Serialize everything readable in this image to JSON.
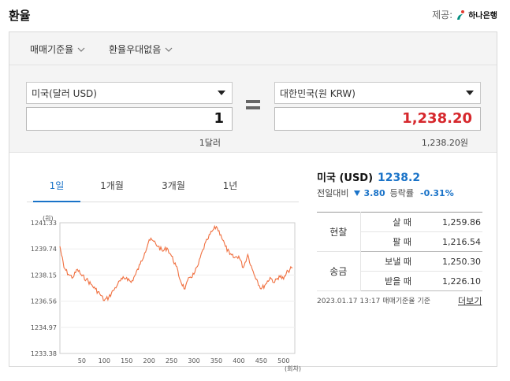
{
  "header": {
    "title": "환율",
    "provider_label": "제공:",
    "provider_name": "하나은행"
  },
  "tabs": [
    {
      "label": "매매기준율"
    },
    {
      "label": "환율우대없음"
    }
  ],
  "converter": {
    "from_currency": "미국(달러 USD)",
    "from_amount": "1",
    "from_sub": "1달러",
    "to_currency": "대한민국(원 KRW)",
    "to_amount": "1,238.20",
    "to_sub": "1,238.20원"
  },
  "periods": [
    {
      "label": "1일",
      "active": true
    },
    {
      "label": "1개월",
      "active": false
    },
    {
      "label": "3개월",
      "active": false
    },
    {
      "label": "1년",
      "active": false
    }
  ],
  "summary": {
    "country": "미국 (USD)",
    "rate": "1238.2",
    "compare_label": "전일대비",
    "change": "3.80",
    "ratio_label": "등락률",
    "ratio": "-0.31%"
  },
  "rates": {
    "cash_label": "현찰",
    "remit_label": "송금",
    "rows": [
      {
        "kind": "살 때",
        "value": "1,259.86"
      },
      {
        "kind": "팔 때",
        "value": "1,216.54"
      },
      {
        "kind": "보낼 때",
        "value": "1,250.30"
      },
      {
        "kind": "받을 때",
        "value": "1,226.10"
      }
    ]
  },
  "footer": {
    "basis": "2023.01.17 13:17 매매기준율 기준",
    "more": "더보기"
  },
  "colors": {
    "accent": "#1a73c8",
    "krw_amount": "#d6282d",
    "line": "#f07040"
  },
  "chart_data": {
    "type": "line",
    "ylabel": "(원)",
    "xlabel": "(회차)",
    "yticks": [
      "1241.33",
      "1239.74",
      "1238.15",
      "1236.56",
      "1234.97",
      "1233.38"
    ],
    "xticks": [
      "50",
      "100",
      "150",
      "200",
      "250",
      "300",
      "350",
      "400",
      "450",
      "500"
    ],
    "ylim": [
      1233.38,
      1241.33
    ],
    "xlim": [
      1,
      525
    ],
    "x": [
      1,
      10,
      20,
      30,
      40,
      50,
      60,
      70,
      80,
      90,
      100,
      110,
      120,
      130,
      140,
      150,
      160,
      170,
      180,
      190,
      200,
      210,
      220,
      230,
      240,
      250,
      260,
      270,
      280,
      290,
      300,
      310,
      320,
      330,
      340,
      350,
      360,
      370,
      380,
      390,
      400,
      410,
      420,
      430,
      440,
      450,
      460,
      470,
      480,
      490,
      500,
      510,
      520
    ],
    "values": [
      1239.9,
      1238.6,
      1238.2,
      1238.0,
      1238.5,
      1238.1,
      1237.9,
      1237.6,
      1237.3,
      1237.0,
      1236.6,
      1236.8,
      1237.2,
      1237.6,
      1237.9,
      1238.0,
      1237.7,
      1238.2,
      1238.8,
      1239.5,
      1240.3,
      1240.2,
      1239.9,
      1239.6,
      1239.8,
      1239.3,
      1238.7,
      1237.8,
      1237.3,
      1238.0,
      1238.2,
      1238.8,
      1239.7,
      1240.3,
      1240.8,
      1241.1,
      1240.6,
      1239.9,
      1239.4,
      1239.2,
      1239.3,
      1238.6,
      1239.4,
      1238.5,
      1237.9,
      1237.3,
      1237.6,
      1238.0,
      1237.7,
      1238.1,
      1237.9,
      1238.4,
      1238.6
    ]
  }
}
